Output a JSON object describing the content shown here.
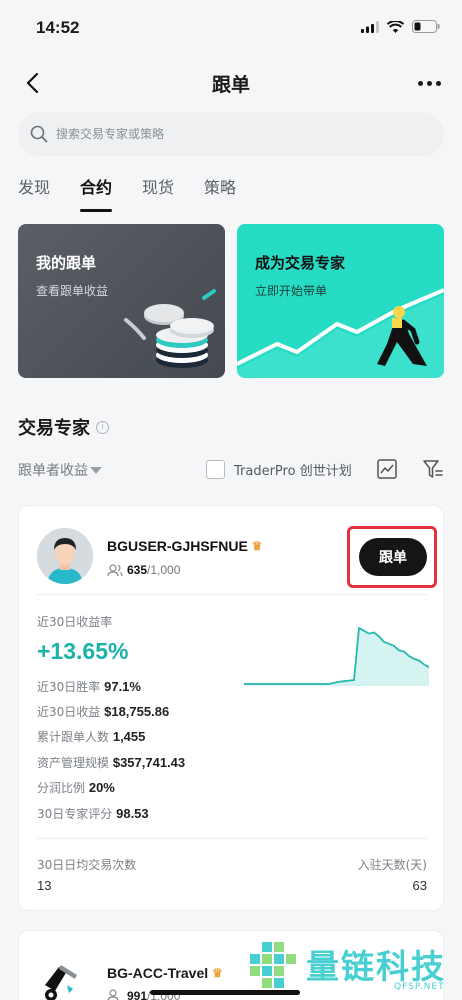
{
  "status_bar": {
    "time": "14:52"
  },
  "nav": {
    "title": "跟单"
  },
  "search": {
    "placeholder": "搜索交易专家或策略"
  },
  "tabs": [
    {
      "label": "发现",
      "active": false
    },
    {
      "label": "合约",
      "active": true
    },
    {
      "label": "现货",
      "active": false
    },
    {
      "label": "策略",
      "active": false
    }
  ],
  "promo_cards": [
    {
      "title": "我的跟单",
      "subtitle": "查看跟单收益"
    },
    {
      "title": "成为交易专家",
      "subtitle": "立即开始带单"
    }
  ],
  "section": {
    "title": "交易专家",
    "info_glyph": "i"
  },
  "filters": {
    "sort_label": "跟单者收益",
    "traderpro_label": "TraderPro 创世计划",
    "traderpro_checked": false
  },
  "trader_1": {
    "name": "BGUSER-GJHSFNUE",
    "followers_current": "635",
    "followers_max": "/1,000",
    "follow_button": "跟单",
    "roi_label": "近30日收益率",
    "roi_value": "+13.65%",
    "stats": [
      {
        "label": "近30日胜率",
        "value": "97.1%"
      },
      {
        "label": "近30日收益",
        "value": "$18,755.86"
      },
      {
        "label": "累计跟单人数",
        "value": "1,455"
      },
      {
        "label": "资产管理规模",
        "value": "$357,741.43"
      },
      {
        "label": "分润比例",
        "value": "20%"
      },
      {
        "label": "30日专家评分",
        "value": "98.53"
      }
    ],
    "footer_left_label": "30日日均交易次数",
    "footer_left_value": "13",
    "footer_right_label": "入驻天数(天)",
    "footer_right_value": "63",
    "sparkline": [
      0.0,
      0.0,
      0.0,
      0.0,
      0.0,
      0.0,
      0.0,
      0.0,
      0.0,
      0.0,
      0.0,
      0.0,
      0.0,
      0.0,
      0.0,
      0.0,
      0.0,
      0.0,
      0.02,
      0.04,
      0.05,
      0.06,
      0.07,
      1.0,
      0.95,
      0.9,
      0.92,
      0.85,
      0.75,
      0.72,
      0.68,
      0.6,
      0.58,
      0.5,
      0.45,
      0.42,
      0.35,
      0.3
    ],
    "colors": {
      "roi": "#1ab3a8",
      "line": "#27b8b0",
      "area": "#d5f3f0"
    }
  },
  "trader_2": {
    "name": "BG-ACC-Travel",
    "followers_current": "991",
    "followers_max": "/1,000"
  },
  "watermark": {
    "text": "量链科技",
    "url": "QFSP.NET"
  }
}
